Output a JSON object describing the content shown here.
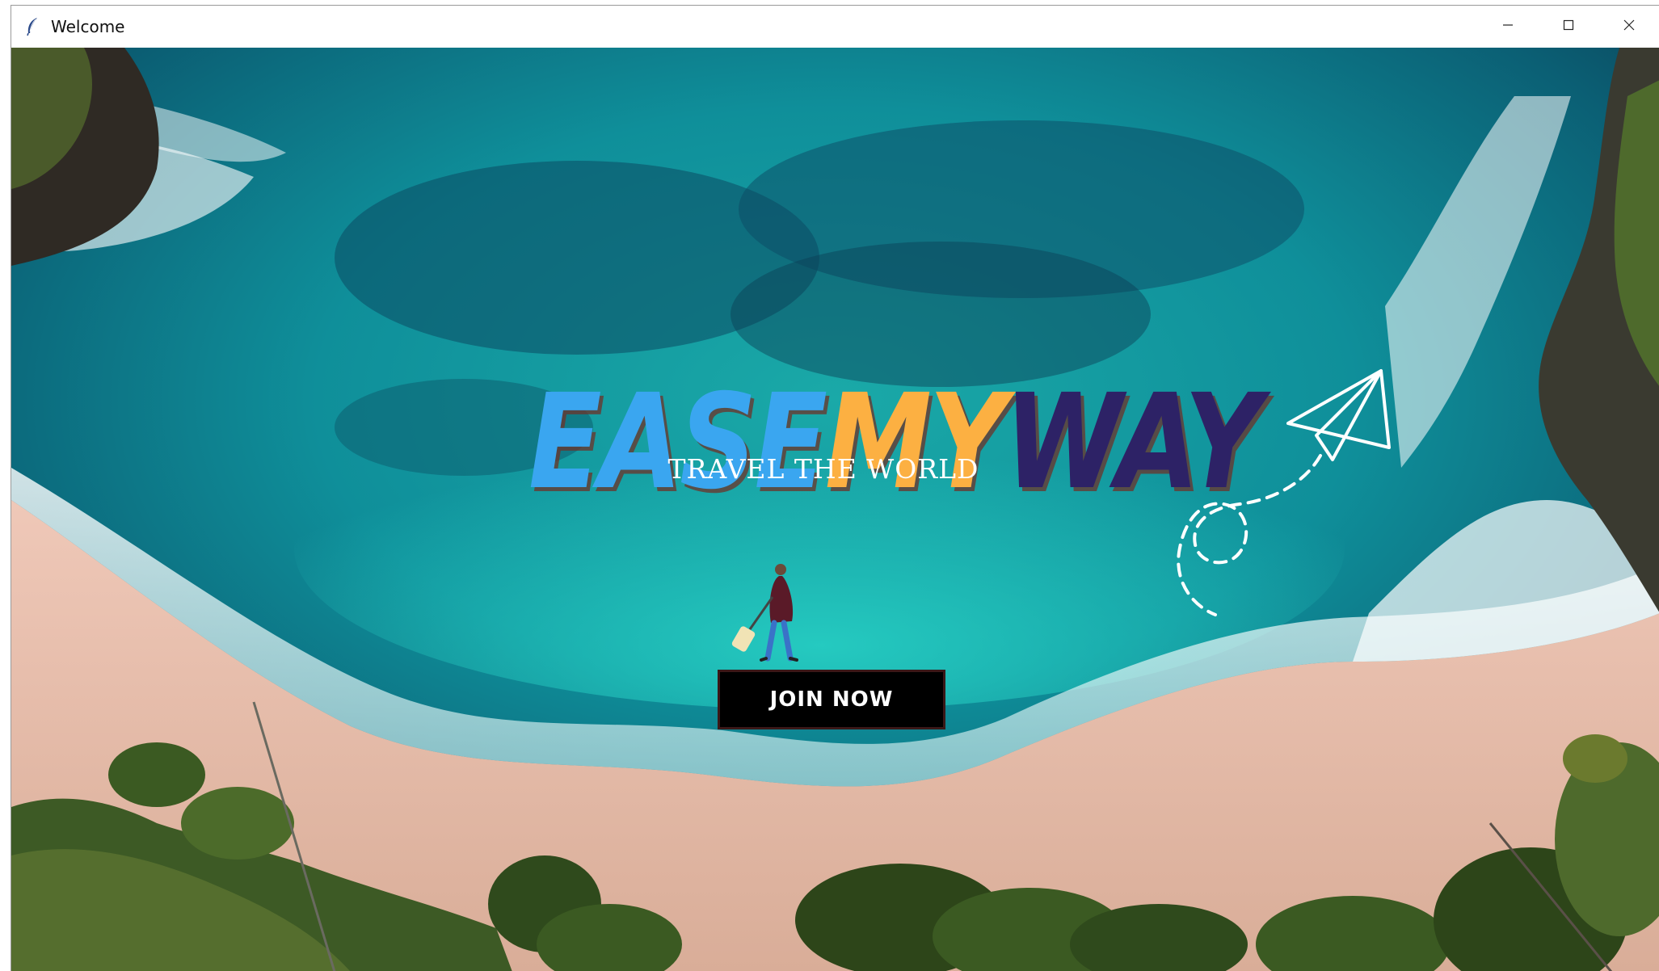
{
  "window": {
    "title": "Welcome",
    "app_icon": "feather-icon",
    "controls": {
      "minimize": "minimize-icon",
      "maximize": "maximize-icon",
      "close": "close-icon"
    }
  },
  "hero": {
    "logo": {
      "part1": "EASE",
      "part2": "MY",
      "part3": "WAY"
    },
    "tagline": "TRAVEL THE WORLD",
    "join_button": "JOIN NOW"
  },
  "colors": {
    "logo_part1": "#3aa6f0",
    "logo_part2": "#fcb042",
    "logo_part3": "#2d2266",
    "button_bg": "#000000",
    "tagline": "#ffffff"
  }
}
